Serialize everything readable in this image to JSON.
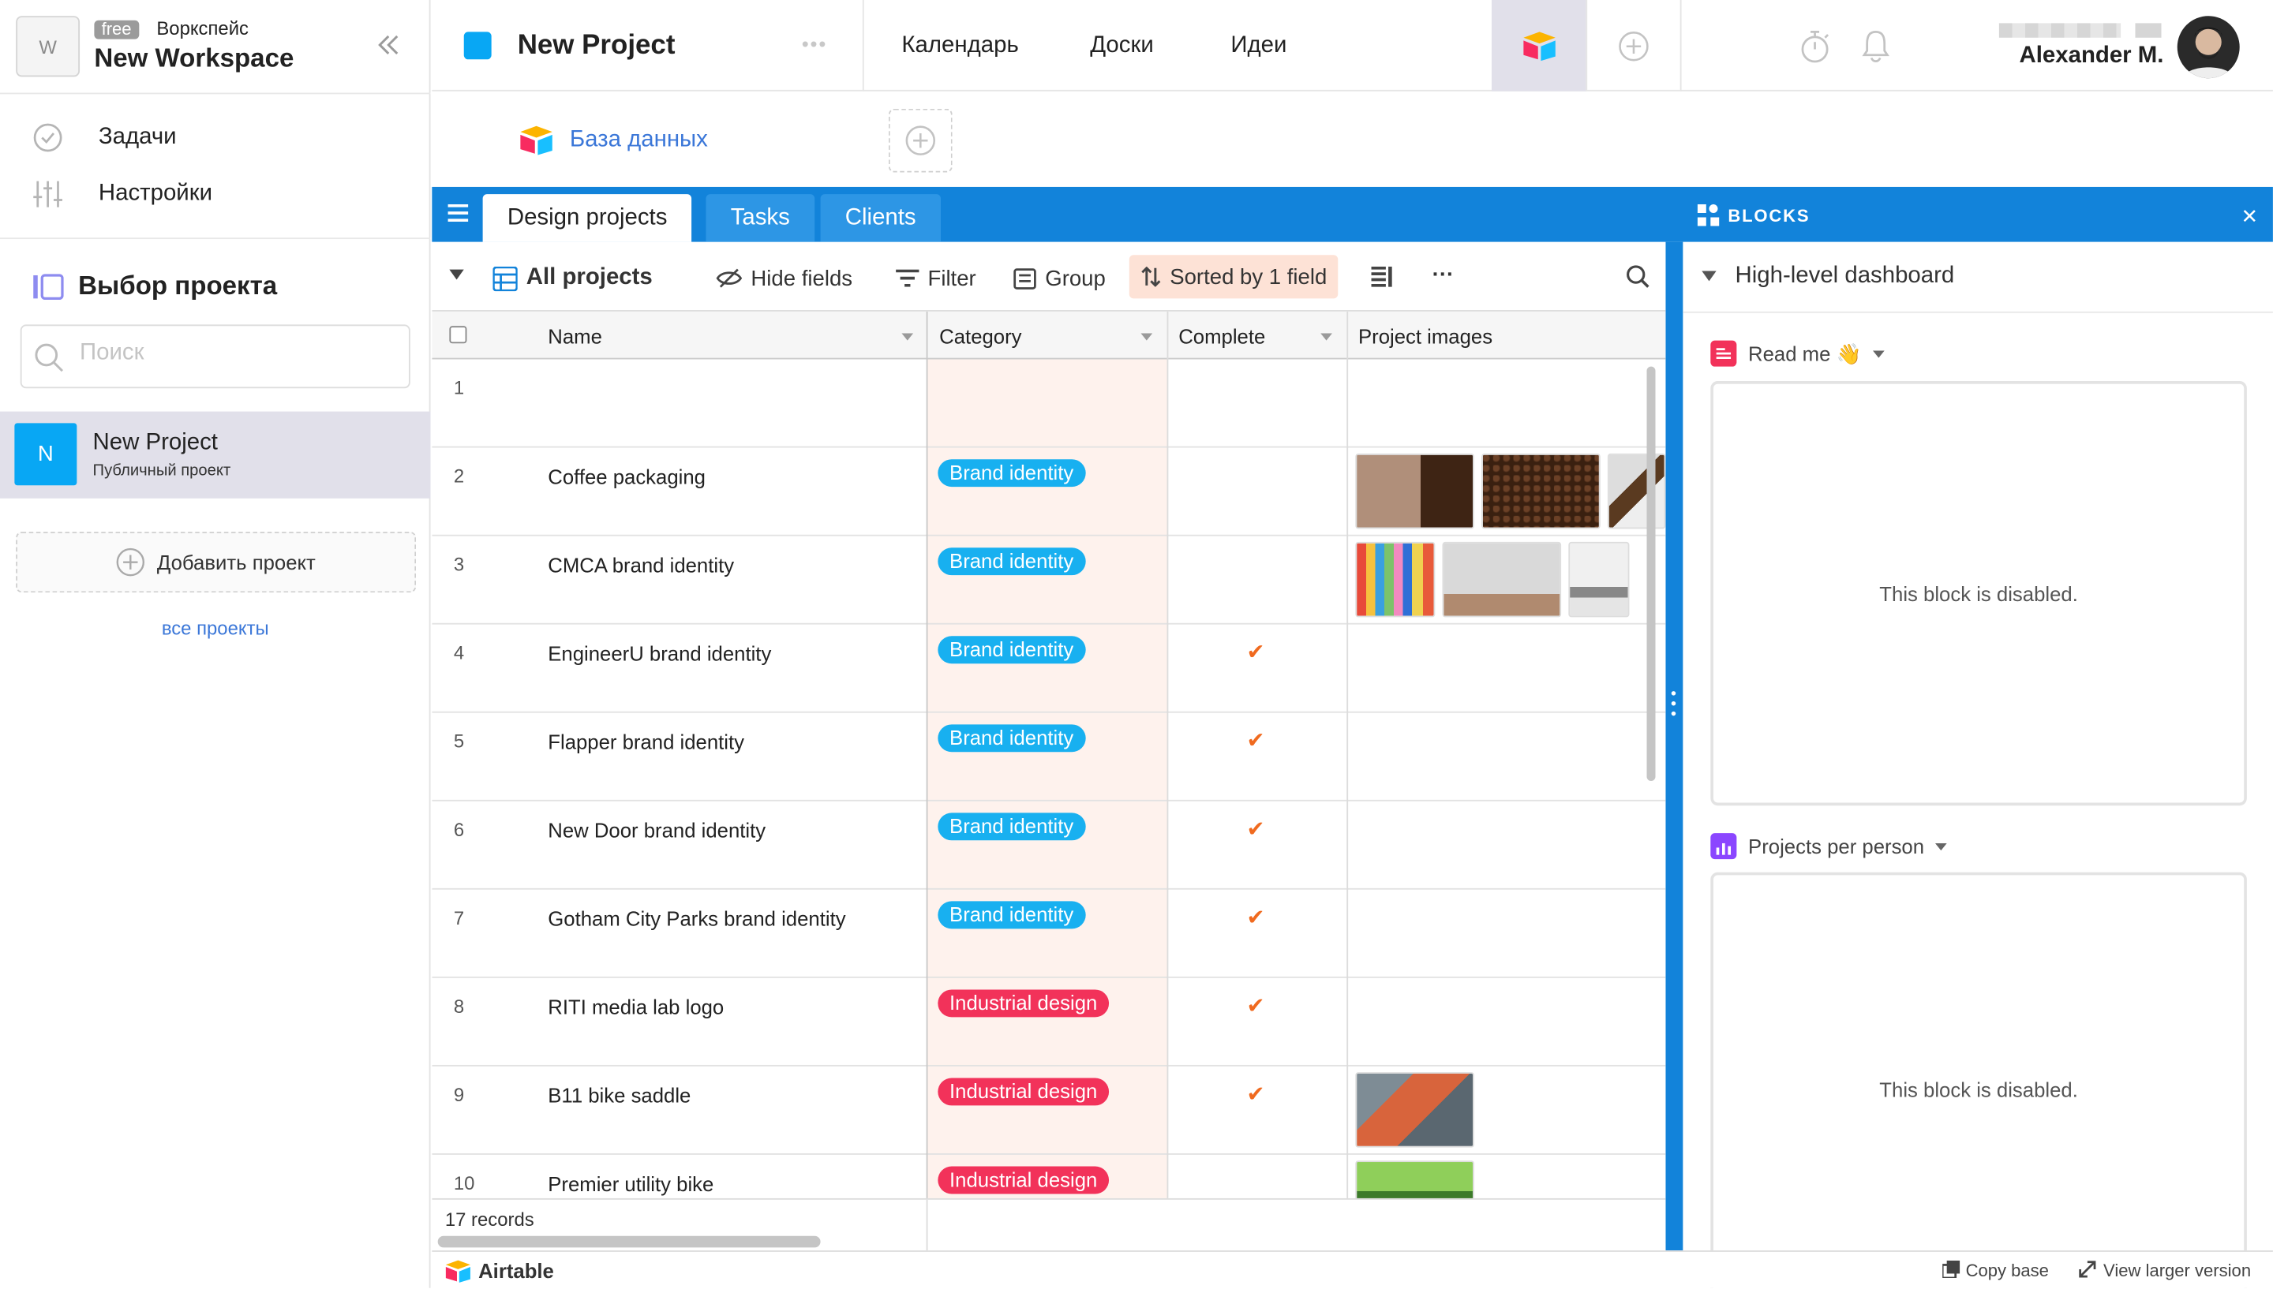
{
  "workspace": {
    "avatar": "W",
    "plan_badge": "free",
    "label": "Воркспейс",
    "name": "New Workspace"
  },
  "sidebar": {
    "menu": [
      {
        "label": "Задачи",
        "icon": "check-circle-icon"
      },
      {
        "label": "Настройки",
        "icon": "sliders-icon"
      }
    ],
    "section_title": "Выбор проекта",
    "search_placeholder": "Поиск",
    "project": {
      "avatar": "N",
      "name": "New Project",
      "subtitle": "Публичный проект"
    },
    "add_project": "Добавить проект",
    "all_projects": "все проекты"
  },
  "topbar": {
    "project_title": "New Project",
    "project_color": "#08a7f4",
    "nav": [
      "Календарь",
      "Доски",
      "Идеи"
    ],
    "user_name": "Alexander M."
  },
  "base": {
    "label": "База данных"
  },
  "tables": [
    "Design projects",
    "Tasks",
    "Clients"
  ],
  "toolbar": {
    "view": "All projects",
    "hide_fields": "Hide fields",
    "filter": "Filter",
    "group": "Group",
    "sorted": "Sorted by 1 field",
    "more": "···"
  },
  "columns": [
    "Name",
    "Category",
    "Complete",
    "Project images"
  ],
  "rows": [
    {
      "n": "1",
      "name": "",
      "category": "",
      "complete": false,
      "images": 0
    },
    {
      "n": "2",
      "name": "Coffee packaging",
      "category": "Brand identity",
      "complete": false,
      "images": 3
    },
    {
      "n": "3",
      "name": "CMCA brand identity",
      "category": "Brand identity",
      "complete": false,
      "images": 3
    },
    {
      "n": "4",
      "name": "EngineerU brand identity",
      "category": "Brand identity",
      "complete": true,
      "images": 0
    },
    {
      "n": "5",
      "name": "Flapper brand identity",
      "category": "Brand identity",
      "complete": true,
      "images": 0
    },
    {
      "n": "6",
      "name": "New Door brand identity",
      "category": "Brand identity",
      "complete": true,
      "images": 0
    },
    {
      "n": "7",
      "name": "Gotham City Parks brand identity",
      "category": "Brand identity",
      "complete": true,
      "images": 0
    },
    {
      "n": "8",
      "name": "RITI media lab logo",
      "category": "Industrial design",
      "complete": true,
      "images": 0
    },
    {
      "n": "9",
      "name": "B11 bike saddle",
      "category": "Industrial design",
      "complete": true,
      "images": 1
    },
    {
      "n": "10",
      "name": "Premier utility bike",
      "category": "Industrial design",
      "complete": false,
      "images": 1
    }
  ],
  "category_colors": {
    "Brand identity": "#18b0f0",
    "Industrial design": "#f2325a"
  },
  "records_count": "17 records",
  "blocks": {
    "header": "BLOCKS",
    "dashboard": "High-level dashboard",
    "items": [
      {
        "title": "Read me 👋",
        "icon": "read-me-icon",
        "color": "#f2325a",
        "message": "This block is disabled."
      },
      {
        "title": "Projects per person",
        "icon": "bar-chart-icon",
        "color": "#8b46ff",
        "message": "This block is disabled."
      }
    ]
  },
  "bottom": {
    "brand": "Airtable",
    "copy": "Copy base",
    "view_larger": "View larger version"
  }
}
